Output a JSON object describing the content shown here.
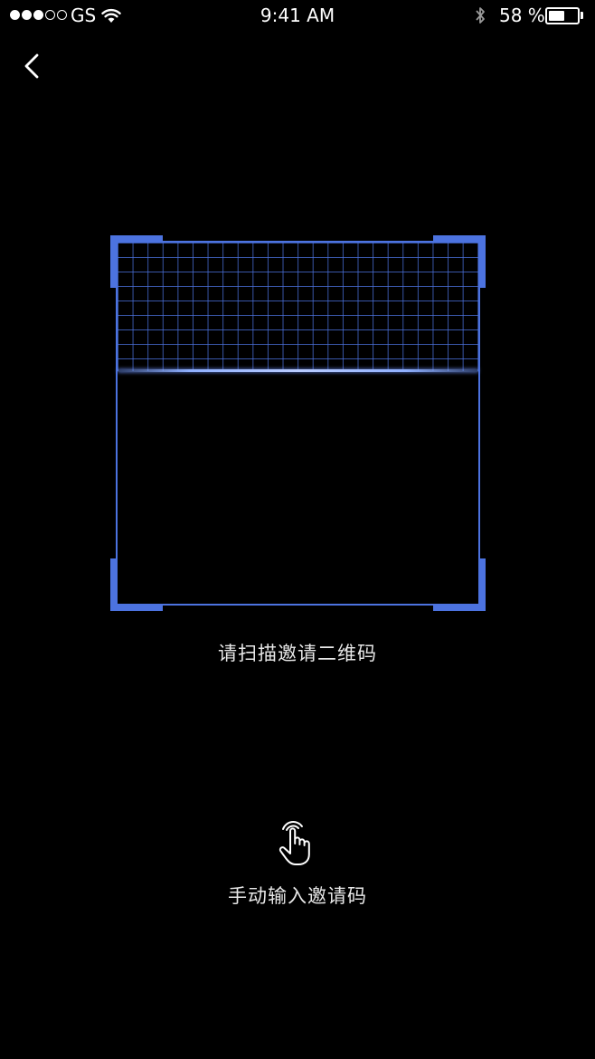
{
  "status_bar": {
    "carrier": "GS",
    "time": "9:41 AM",
    "battery_percent": "58 %",
    "battery_level": 0.58,
    "signal_bars_filled": 3,
    "signal_bars_total": 5
  },
  "navigation": {
    "back_icon": "chevron-left-icon"
  },
  "scanner": {
    "accent_color": "#4C73E0",
    "hint": "请扫描邀请二维码"
  },
  "manual_entry": {
    "icon": "hand-pointer-icon",
    "label": "手动输入邀请码"
  }
}
